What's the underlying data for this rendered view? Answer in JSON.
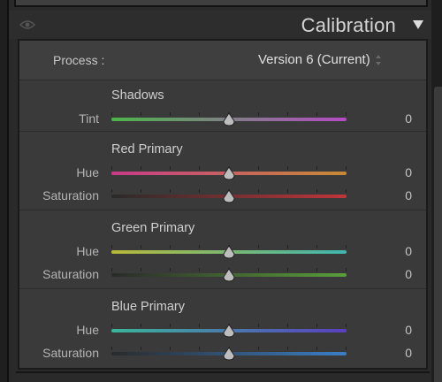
{
  "header": {
    "title": "Calibration"
  },
  "process": {
    "label": "Process :",
    "value": "Version 6 (Current)"
  },
  "sections": [
    {
      "title": "Shadows",
      "rows": [
        {
          "label": "Tint",
          "value": "0",
          "slider": 0.5
        }
      ]
    },
    {
      "title": "Red Primary",
      "rows": [
        {
          "label": "Hue",
          "value": "0",
          "slider": 0.5
        },
        {
          "label": "Saturation",
          "value": "0",
          "slider": 0.5
        }
      ]
    },
    {
      "title": "Green Primary",
      "rows": [
        {
          "label": "Hue",
          "value": "0",
          "slider": 0.5
        },
        {
          "label": "Saturation",
          "value": "0",
          "slider": 0.5
        }
      ]
    },
    {
      "title": "Blue Primary",
      "rows": [
        {
          "label": "Hue",
          "value": "0",
          "slider": 0.5
        },
        {
          "label": "Saturation",
          "value": "0",
          "slider": 0.5
        }
      ]
    }
  ],
  "colors": {
    "tint_gradient": [
      "#4cb54a",
      "#b54ac4"
    ],
    "red_hue_gradient": [
      "#c93b8a",
      "#c78a35"
    ],
    "red_sat_gradient": [
      "#2a2a2a",
      "#c0353a"
    ],
    "green_hue_gradient": [
      "#b6b83a",
      "#3fb6ad"
    ],
    "green_sat_gradient": [
      "#2a2a2a",
      "#5a9e3a"
    ],
    "blue_hue_gradient": [
      "#3ab59a",
      "#5a3fc0"
    ],
    "blue_sat_gradient": [
      "#2a2a2a",
      "#3b7ec6"
    ]
  }
}
